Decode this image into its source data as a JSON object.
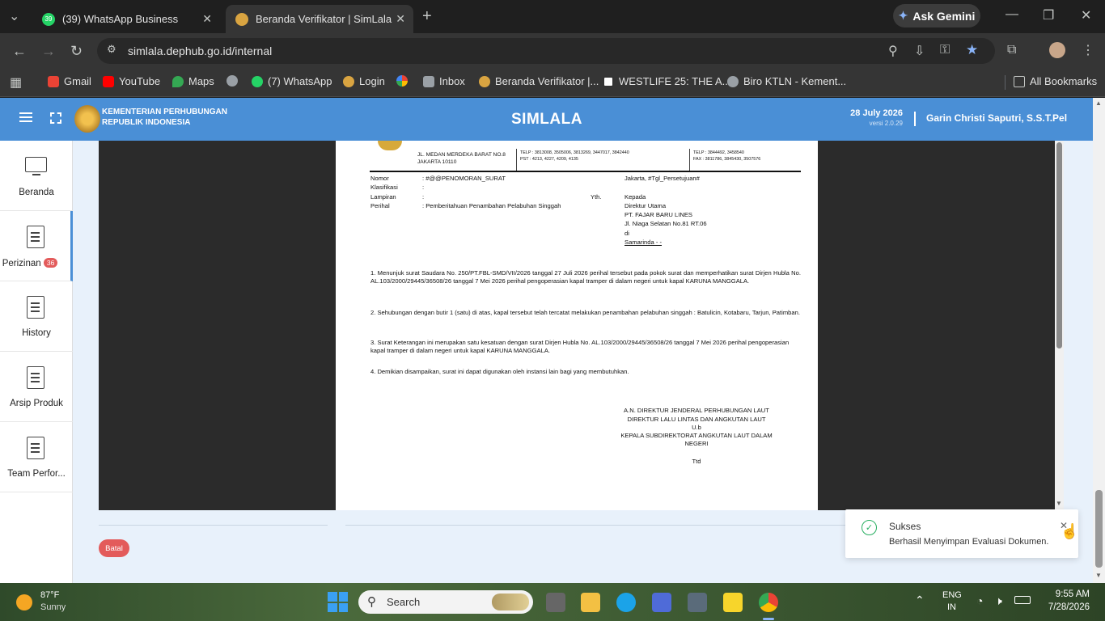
{
  "browser": {
    "tabs": [
      {
        "title": "(39) WhatsApp Business",
        "favicon": "whatsapp-icon",
        "badge": "39",
        "active": false
      },
      {
        "title": "Beranda Verifikator | SimLala",
        "favicon": "simlala-icon",
        "active": true
      }
    ],
    "ask_gemini": "Ask Gemini",
    "url": "simlala.dephub.go.id/internal",
    "bookmarks": [
      "Gmail",
      "YouTube",
      "Maps",
      "(7) WhatsApp",
      "Login",
      "Inbox",
      "Beranda Verifikator |...",
      "WESTLIFE 25: THE A...",
      "Biro KTLN - Kement..."
    ],
    "all_bookmarks": "All Bookmarks"
  },
  "header": {
    "org_line1": "KEMENTERIAN PERHUBUNGAN",
    "org_line2": "REPUBLIK INDONESIA",
    "app_title": "SIMLALA",
    "date": "28 July 2026",
    "version": "versi 2.0.29",
    "user": "Garin Christi Saputri, S.S.T.Pel"
  },
  "sidebar": {
    "items": [
      {
        "label": "Beranda",
        "icon": "monitor-icon"
      },
      {
        "label": "Perizinan",
        "icon": "document-icon",
        "badge": "36",
        "active": true
      },
      {
        "label": "History",
        "icon": "document-icon"
      },
      {
        "label": "Arsip Produk",
        "icon": "document-icon"
      },
      {
        "label": "Team Perfor...",
        "icon": "document-icon"
      }
    ]
  },
  "letter": {
    "address_line1": "JL. MEDAN MERDEKA BARAT NO.8",
    "address_line2": "JAKARTA 10110",
    "telp1": "TELP : 3813008, 3505006, 3813269, 3447017, 3842440",
    "pst": "PST : 4213, 4227, 4209, 4135",
    "telp2": "TELP : 3844492, 3458540",
    "fax": "FAX : 3811786, 3845430, 3507576",
    "nomor_label": "Nomor",
    "nomor_value": ": #@@PENOMORAN_SURAT",
    "klasifikasi_label": "Klasifikasi",
    "klasifikasi_value": ":",
    "lampiran_label": "Lampiran",
    "lampiran_value": ":",
    "perihal_label": "Perihal",
    "perihal_value": ": Pemberitahuan Penambahan Pelabuhan Singgah",
    "place_date": "Jakarta, #Tgl_Persetujuan#",
    "yth": "Yth.",
    "recipient": [
      "Kepada",
      "Direktur Utama",
      "PT. FAJAR BARU LINES",
      "Jl. Niaga Selatan No.81 RT.06",
      "di",
      "Samarinda - -"
    ],
    "paragraphs": [
      "1. Menunjuk surat Saudara No.  250/PT.FBL-SMD/VII/2026 tanggal  27 Juli 2026 perihal tersebut pada pokok surat dan memperhatikan surat Dirjen Hubla No.  AL.103/2000/29445/36508/26 tanggal  7 Mei 2026 perihal pengoperasian kapal tramper di dalam negeri untuk kapal KARUNA MANGGALA.",
      "2. Sehubungan dengan butir 1 (satu) di atas, kapal tersebut telah tercatat melakukan penambahan pelabuhan singgah : Batulicin, Kotabaru, Tarjun, Patimban.",
      "3. Surat Keterangan ini merupakan satu kesatuan dengan surat Dirjen Hubla No.  AL.103/2000/29445/36508/26 tanggal  7 Mei 2026 perihal pengoperasian kapal tramper di dalam negeri untuk kapal KARUNA MANGGALA.",
      "4. Demikian disampaikan,  surat ini dapat  digunakan oleh instansi lain bagi yang membutuhkan."
    ],
    "signature": [
      "A.N. DIREKTUR JENDERAL PERHUBUNGAN LAUT",
      "DIREKTUR LALU LINTAS DAN ANGKUTAN LAUT",
      "U.b",
      "KEPALA SUBDIREKTORAT ANGKUTAN LAUT DALAM",
      "NEGERI",
      "",
      "Ttd"
    ]
  },
  "footer": {
    "cancel_label": "Batal"
  },
  "toast": {
    "title": "Sukses",
    "message": "Berhasil Menyimpan Evaluasi Dokumen."
  },
  "taskbar": {
    "weather_temp": "87°F",
    "weather_desc": "Sunny",
    "search_placeholder": "Search",
    "lang1": "ENG",
    "lang2": "IN",
    "time": "9:55 AM",
    "date": "7/28/2026"
  },
  "colors": {
    "header": "#4a8fd6",
    "accent_red": "#e35b5b",
    "success": "#27ae60"
  }
}
